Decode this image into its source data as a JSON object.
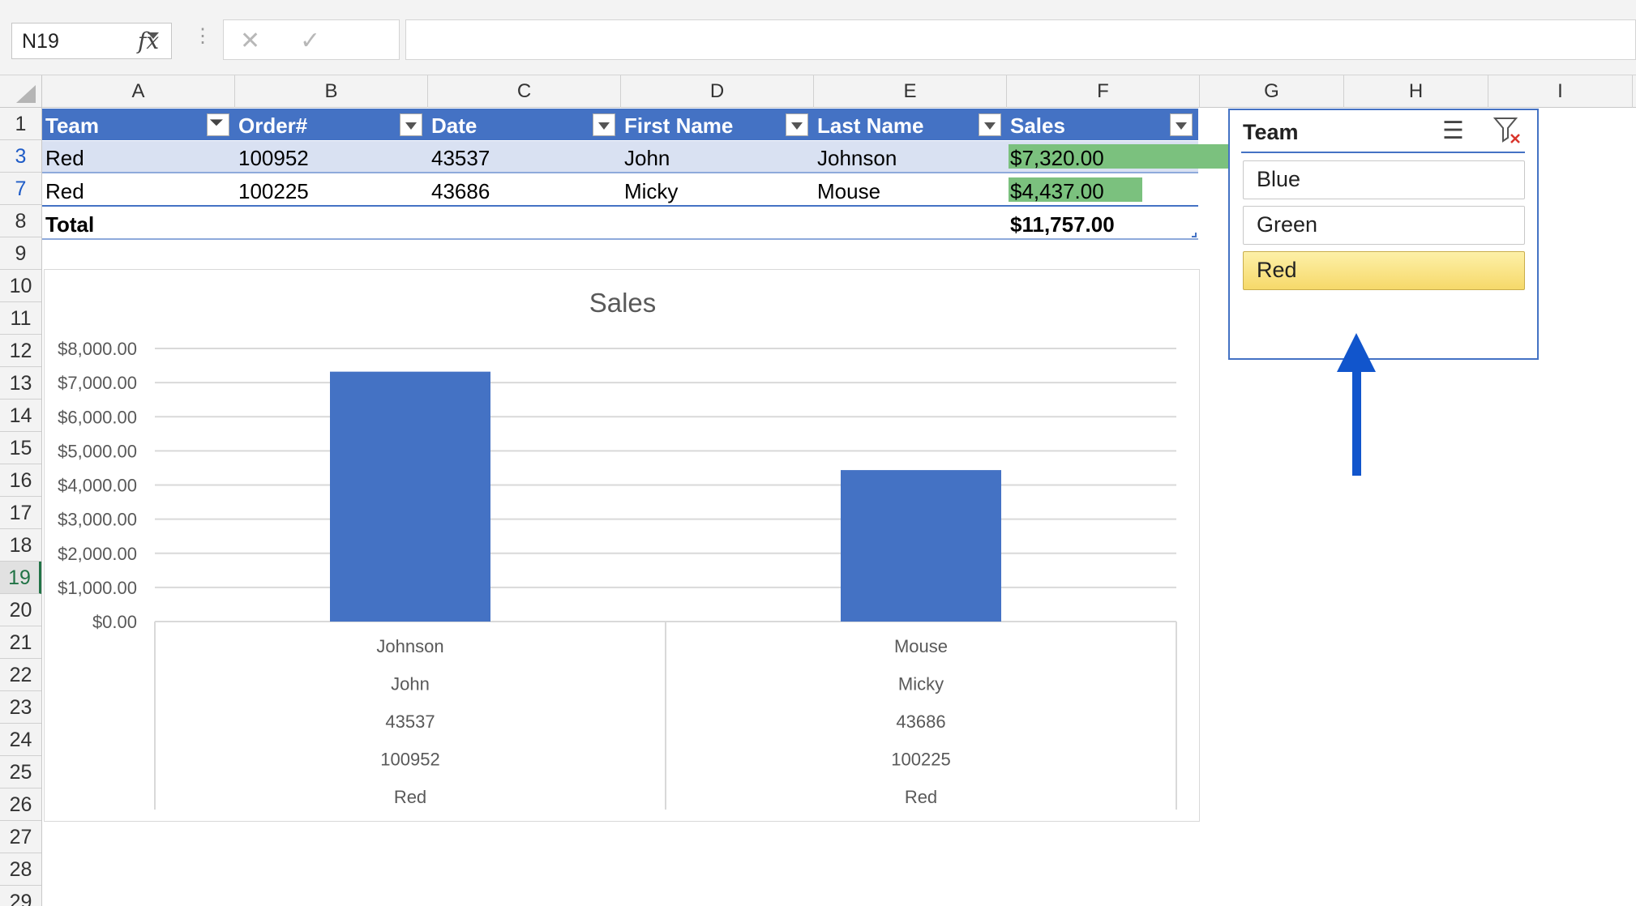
{
  "formula_bar": {
    "name_box": "N19",
    "formula": ""
  },
  "columns": [
    "A",
    "B",
    "C",
    "D",
    "E",
    "F",
    "G",
    "H",
    "I"
  ],
  "rows": [
    "1",
    "3",
    "7",
    "8",
    "9",
    "10",
    "11",
    "12",
    "13",
    "14",
    "15",
    "16",
    "17",
    "18",
    "19",
    "20",
    "21",
    "22",
    "23",
    "24",
    "25",
    "26",
    "27",
    "28",
    "29"
  ],
  "table": {
    "headers": [
      "Team",
      "Order#",
      "Date",
      "First Name",
      "Last Name",
      "Sales"
    ],
    "rows": [
      {
        "team": "Red",
        "order": "100952",
        "date": "43537",
        "first": "John",
        "last": "Johnson",
        "sales": "$7,320.00",
        "sales_fraction": 0.6226
      },
      {
        "team": "Red",
        "order": "100225",
        "date": "43686",
        "first": "Micky",
        "last": "Mouse",
        "sales": "$4,437.00",
        "sales_fraction": 0.3774
      }
    ],
    "total_label": "Total",
    "total_value": "$11,757.00",
    "header_color": "#4472c4",
    "databar_color": "#7bc17e"
  },
  "chart_data": {
    "type": "bar",
    "title": "Sales",
    "categories": [
      [
        "Johnson",
        "John",
        "43537",
        "100952",
        "Red"
      ],
      [
        "Mouse",
        "Micky",
        "43686",
        "100225",
        "Red"
      ]
    ],
    "values": [
      7320,
      4437
    ],
    "ylim": [
      0,
      8000
    ],
    "yticks": [
      "$8,000.00",
      "$7,000.00",
      "$6,000.00",
      "$5,000.00",
      "$4,000.00",
      "$3,000.00",
      "$2,000.00",
      "$1,000.00",
      "$0.00"
    ],
    "grid": true,
    "bar_color": "#4472c4"
  },
  "slicer": {
    "title": "Team",
    "items": [
      "Blue",
      "Green",
      "Red"
    ],
    "selected": "Red",
    "icons": [
      "multi-select-icon",
      "clear-filter-icon"
    ]
  },
  "annotation": {
    "type": "arrow",
    "color": "#1155cc"
  }
}
